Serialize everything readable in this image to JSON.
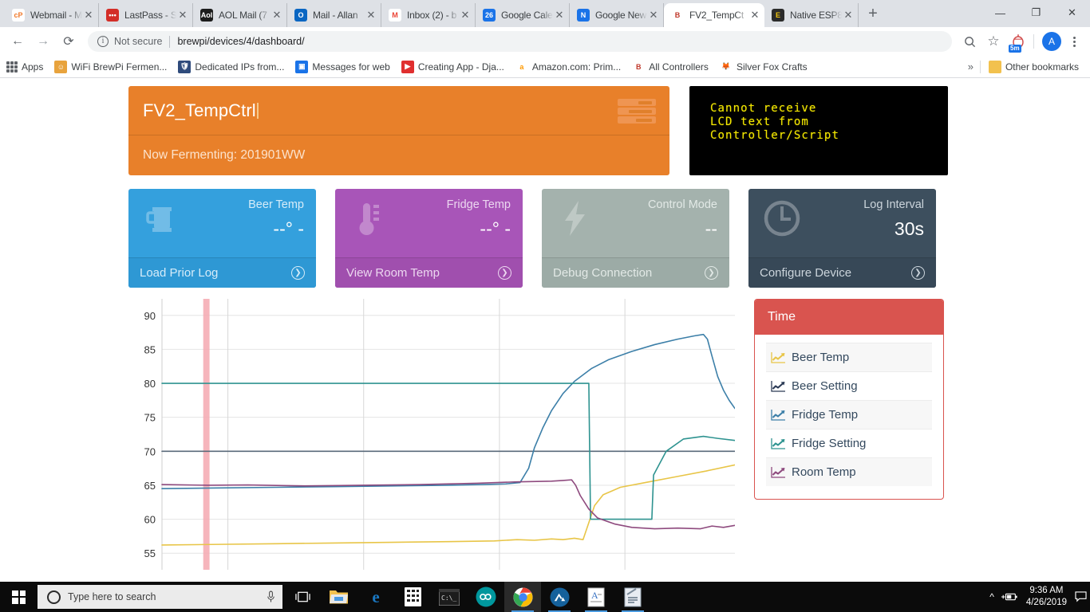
{
  "browser": {
    "tabs": [
      {
        "title": "Webmail - M",
        "icon": "cpanel-icon",
        "glyph": "cP",
        "bg": "#ffffff",
        "fg": "#f0792b",
        "active": false
      },
      {
        "title": "LastPass - S",
        "icon": "lastpass-icon",
        "glyph": "•••",
        "bg": "#d32d27",
        "fg": "#ffffff",
        "active": false
      },
      {
        "title": "AOL Mail (7",
        "icon": "aol-icon",
        "glyph": "Aol",
        "bg": "#1c1c1c",
        "fg": "#ffffff",
        "active": false
      },
      {
        "title": "Mail - Allan",
        "icon": "outlook-icon",
        "glyph": "O",
        "bg": "#0a66c2",
        "fg": "#ffffff",
        "active": false
      },
      {
        "title": "Inbox (2) - b",
        "icon": "gmail-icon",
        "glyph": "M",
        "bg": "#ffffff",
        "fg": "#ea4335",
        "active": false
      },
      {
        "title": "Google Cale",
        "icon": "google-calendar-icon",
        "glyph": "26",
        "bg": "#1a73e8",
        "fg": "#ffffff",
        "active": false
      },
      {
        "title": "Google New",
        "icon": "google-news-icon",
        "glyph": "N",
        "bg": "#1a73e8",
        "fg": "#ffffff",
        "active": false
      },
      {
        "title": "FV2_TempCt",
        "icon": "brewpi-icon",
        "glyph": "B",
        "bg": "#ffffff",
        "fg": "#c0392b",
        "active": true
      },
      {
        "title": "Native ESP8",
        "icon": "esp-icon",
        "glyph": "E",
        "bg": "#2b2b2b",
        "fg": "#f1c40f",
        "active": false
      }
    ],
    "new_tab_label": "+",
    "close_glyph": "✕",
    "window_controls": {
      "minimize": "—",
      "maximize": "❐",
      "close": "✕"
    },
    "nav": {
      "back": "←",
      "forward": "→",
      "reload": "⟳"
    },
    "omnibox": {
      "info_glyph": "i",
      "security_label": "Not secure",
      "url": "brewpi/devices/4/dashboard/"
    },
    "toolbar_icons": {
      "search": "🔍",
      "bookmark_star": "☆",
      "extension_badge": "5m",
      "profile_initial": "A"
    },
    "bookmarks": [
      {
        "label": "Apps",
        "icon": "apps-grid-icon",
        "glyph": "",
        "bg": "transparent",
        "fg": "#5f6368"
      },
      {
        "label": "WiFi BrewPi Fermen...",
        "icon": "person-icon",
        "glyph": "☺",
        "bg": "#e8a33d",
        "fg": "#ffffff"
      },
      {
        "label": "Dedicated IPs from...",
        "icon": "shield-icon",
        "glyph": "🛡",
        "bg": "#2f4b7c",
        "fg": "#ffffff"
      },
      {
        "label": "Messages for web",
        "icon": "messages-icon",
        "glyph": "▣",
        "bg": "#1a73e8",
        "fg": "#ffffff"
      },
      {
        "label": "Creating App - Dja...",
        "icon": "youtube-icon",
        "glyph": "▶",
        "bg": "#e02f2f",
        "fg": "#ffffff"
      },
      {
        "label": "Amazon.com: Prim...",
        "icon": "amazon-icon",
        "glyph": "a",
        "bg": "#ffffff",
        "fg": "#ff9900"
      },
      {
        "label": "All Controllers",
        "icon": "brewpi-icon",
        "glyph": "B",
        "bg": "#ffffff",
        "fg": "#c0392b"
      },
      {
        "label": "Silver Fox Crafts",
        "icon": "fox-icon",
        "glyph": "🦊",
        "bg": "#ffffff",
        "fg": "#888888"
      }
    ],
    "bookmarks_overflow": "»",
    "other_bookmarks": {
      "label": "Other bookmarks",
      "icon": "folder-icon"
    }
  },
  "dashboard": {
    "device_title": "FV2_TempCtrl",
    "now_fermenting": "Now Fermenting: 201901WW",
    "menu_icon": "list-settings-icon",
    "lcd": {
      "line1": "Cannot receive",
      "line2": "LCD text from",
      "line3": "Controller/Script",
      "text_color": "#f2e600",
      "bg_color": "#000000"
    },
    "cards": [
      {
        "label": "Beer Temp",
        "value": "--° -",
        "action": "Load Prior Log",
        "icon": "beer-mug-icon",
        "color": "#34a0dd",
        "theme": "c-blue"
      },
      {
        "label": "Fridge Temp",
        "value": "--° -",
        "action": "View Room Temp",
        "icon": "thermometer-icon",
        "color": "#a855b8",
        "theme": "c-purple"
      },
      {
        "label": "Control Mode",
        "value": "--",
        "action": "Debug Connection",
        "icon": "bolt-icon",
        "color": "#a4b2ad",
        "theme": "c-gray"
      },
      {
        "label": "Log Interval",
        "value": "30s",
        "action": "Configure Device",
        "icon": "clock-icon",
        "color": "#3d4f5e",
        "theme": "c-navy"
      }
    ],
    "legend": {
      "title": "Time",
      "header_color": "#d9544f",
      "items": [
        {
          "label": "Beer Temp",
          "color": "#e8c547",
          "icon": "line-chart-icon"
        },
        {
          "label": "Beer Setting",
          "color": "#2b3a55",
          "icon": "line-chart-icon"
        },
        {
          "label": "Fridge Temp",
          "color": "#3c7fa8",
          "icon": "line-chart-icon"
        },
        {
          "label": "Fridge Setting",
          "color": "#2e9390",
          "icon": "line-chart-icon"
        },
        {
          "label": "Room Temp",
          "color": "#8e4a7e",
          "icon": "line-chart-icon"
        }
      ]
    }
  },
  "chart_data": {
    "type": "line",
    "title": "",
    "xlabel": "Time",
    "ylabel": "",
    "ylim": [
      53.5,
      91.5
    ],
    "yticks": [
      55,
      60,
      65,
      70,
      75,
      80,
      85,
      90
    ],
    "grid": true,
    "legend_position": "right-panel",
    "annotations": [
      {
        "type": "vertical-band",
        "color": "#f5a8b0",
        "x_fraction": 0.072,
        "width_fraction": 0.011
      }
    ],
    "x_gridline_fractions": [
      0.115,
      0.352,
      0.589,
      0.808
    ],
    "series": [
      {
        "name": "Beer Temp",
        "color": "#e8c547",
        "points": [
          [
            0.0,
            56.2
          ],
          [
            0.1,
            56.3
          ],
          [
            0.2,
            56.4
          ],
          [
            0.3,
            56.5
          ],
          [
            0.4,
            56.6
          ],
          [
            0.5,
            56.7
          ],
          [
            0.58,
            56.8
          ],
          [
            0.62,
            57.0
          ],
          [
            0.65,
            56.9
          ],
          [
            0.68,
            57.1
          ],
          [
            0.7,
            57.0
          ],
          [
            0.72,
            57.2
          ],
          [
            0.735,
            57.0
          ],
          [
            0.745,
            59.5
          ],
          [
            0.755,
            62.0
          ],
          [
            0.77,
            63.6
          ],
          [
            0.8,
            64.7
          ],
          [
            0.85,
            65.5
          ],
          [
            0.9,
            66.3
          ],
          [
            0.95,
            67.1
          ],
          [
            1.0,
            68.0
          ]
        ]
      },
      {
        "name": "Beer Setting",
        "color": "#5a6a7a",
        "points": [
          [
            0.0,
            70.0
          ],
          [
            1.0,
            70.0
          ]
        ],
        "style": "flat-line"
      },
      {
        "name": "Fridge Temp",
        "color": "#3c7fa8",
        "points": [
          [
            0.0,
            64.5
          ],
          [
            0.1,
            64.6
          ],
          [
            0.2,
            64.7
          ],
          [
            0.3,
            64.8
          ],
          [
            0.4,
            64.9
          ],
          [
            0.5,
            65.0
          ],
          [
            0.56,
            65.1
          ],
          [
            0.6,
            65.2
          ],
          [
            0.625,
            65.4
          ],
          [
            0.64,
            67.5
          ],
          [
            0.65,
            70.5
          ],
          [
            0.665,
            73.5
          ],
          [
            0.68,
            76.0
          ],
          [
            0.7,
            78.5
          ],
          [
            0.72,
            80.3
          ],
          [
            0.75,
            82.2
          ],
          [
            0.78,
            83.5
          ],
          [
            0.82,
            84.7
          ],
          [
            0.86,
            85.7
          ],
          [
            0.9,
            86.5
          ],
          [
            0.93,
            87.0
          ],
          [
            0.945,
            87.2
          ],
          [
            0.952,
            86.5
          ],
          [
            0.96,
            84.0
          ],
          [
            0.97,
            81.0
          ],
          [
            0.98,
            79.0
          ],
          [
            0.99,
            77.5
          ],
          [
            1.0,
            76.3
          ]
        ]
      },
      {
        "name": "Fridge Setting",
        "color": "#2e9390",
        "points": [
          [
            0.0,
            80.0
          ],
          [
            0.745,
            80.0
          ],
          [
            0.748,
            60.0
          ],
          [
            0.855,
            60.0
          ],
          [
            0.858,
            66.5
          ],
          [
            0.88,
            70.0
          ],
          [
            0.91,
            71.8
          ],
          [
            0.945,
            72.2
          ],
          [
            0.97,
            71.9
          ],
          [
            1.0,
            71.6
          ]
        ],
        "style": "step"
      },
      {
        "name": "Room Temp",
        "color": "#8e4a7e",
        "points": [
          [
            0.0,
            65.1
          ],
          [
            0.08,
            65.0
          ],
          [
            0.15,
            65.05
          ],
          [
            0.25,
            64.9
          ],
          [
            0.35,
            65.0
          ],
          [
            0.45,
            65.1
          ],
          [
            0.55,
            65.3
          ],
          [
            0.62,
            65.5
          ],
          [
            0.68,
            65.6
          ],
          [
            0.7,
            65.7
          ],
          [
            0.715,
            65.8
          ],
          [
            0.722,
            65.0
          ],
          [
            0.73,
            63.5
          ],
          [
            0.745,
            61.5
          ],
          [
            0.76,
            60.2
          ],
          [
            0.79,
            59.3
          ],
          [
            0.82,
            58.8
          ],
          [
            0.86,
            58.6
          ],
          [
            0.9,
            58.7
          ],
          [
            0.94,
            58.6
          ],
          [
            0.96,
            59.0
          ],
          [
            0.98,
            58.8
          ],
          [
            1.0,
            59.1
          ]
        ]
      }
    ]
  },
  "taskbar": {
    "start_icon": "windows-logo-icon",
    "search_placeholder": "Type here to search",
    "search_icons": {
      "cortana": "search-circle-icon",
      "mic": "microphone-icon"
    },
    "task_view_icon": "task-view-icon",
    "apps": [
      {
        "name": "file-explorer-icon",
        "glyph": "📁",
        "active": false,
        "running": false
      },
      {
        "name": "edge-icon",
        "glyph": "e",
        "active": false,
        "running": false
      },
      {
        "name": "calculator-icon",
        "glyph": "▦",
        "active": false,
        "running": false
      },
      {
        "name": "command-prompt-icon",
        "glyph": "▭",
        "active": false,
        "running": false
      },
      {
        "name": "arduino-icon",
        "glyph": "∞",
        "active": false,
        "running": false
      },
      {
        "name": "chrome-icon",
        "glyph": "◉",
        "active": true,
        "running": true
      },
      {
        "name": "nordvpn-icon",
        "glyph": "◆",
        "active": false,
        "running": true
      },
      {
        "name": "notepad-icon",
        "glyph": "A",
        "active": false,
        "running": true
      },
      {
        "name": "editor-icon",
        "glyph": "✎",
        "active": false,
        "running": true
      }
    ],
    "tray": {
      "overflow": "^",
      "battery_icon": "battery-charging-icon",
      "notification_icon": "action-center-icon"
    },
    "clock_time": "9:36 AM",
    "clock_date": "4/26/2019"
  }
}
